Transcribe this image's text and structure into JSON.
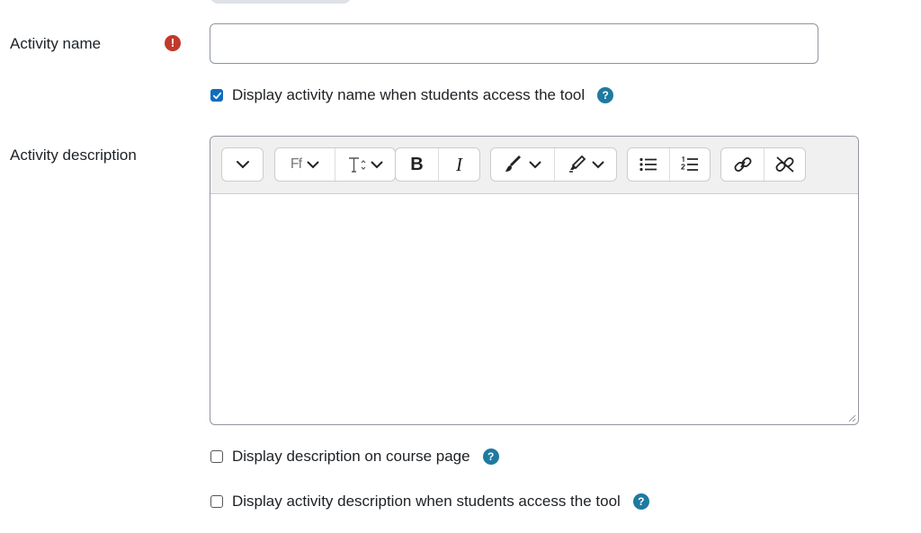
{
  "form": {
    "activity_name": {
      "label": "Activity name",
      "required_icon": "exclamation-circle-icon",
      "value": "",
      "placeholder": ""
    },
    "display_name_checkbox": {
      "label": "Display activity name when students access the tool",
      "checked": true,
      "help_icon": "question-circle-icon"
    },
    "activity_description": {
      "label": "Activity description",
      "toolbar": [
        {
          "group": "menu",
          "icon": "chevron-down-icon"
        },
        {
          "group": "font",
          "icons": [
            "font-family-icon",
            "font-size-icon"
          ],
          "font_family_glyph": "Ff"
        },
        {
          "group": "format",
          "icons": [
            "bold-icon",
            "italic-icon"
          ],
          "bold_glyph": "B",
          "italic_glyph": "I"
        },
        {
          "group": "color",
          "icons": [
            "text-color-icon",
            "highlight-icon"
          ]
        },
        {
          "group": "lists",
          "icons": [
            "bullet-list-icon",
            "numbered-list-icon"
          ]
        },
        {
          "group": "links",
          "icons": [
            "link-icon",
            "unlink-icon"
          ]
        }
      ]
    },
    "show_description_checkbox": {
      "label": "Display description on course page",
      "checked": false,
      "help_icon": "question-circle-icon"
    },
    "display_description_checkbox": {
      "label": "Display activity description when students access the tool",
      "checked": false,
      "help_icon": "question-circle-icon"
    }
  },
  "colors": {
    "required": "#c0392b",
    "help": "#1f7aa0",
    "checkbox_checked": "#0f6cbf"
  }
}
